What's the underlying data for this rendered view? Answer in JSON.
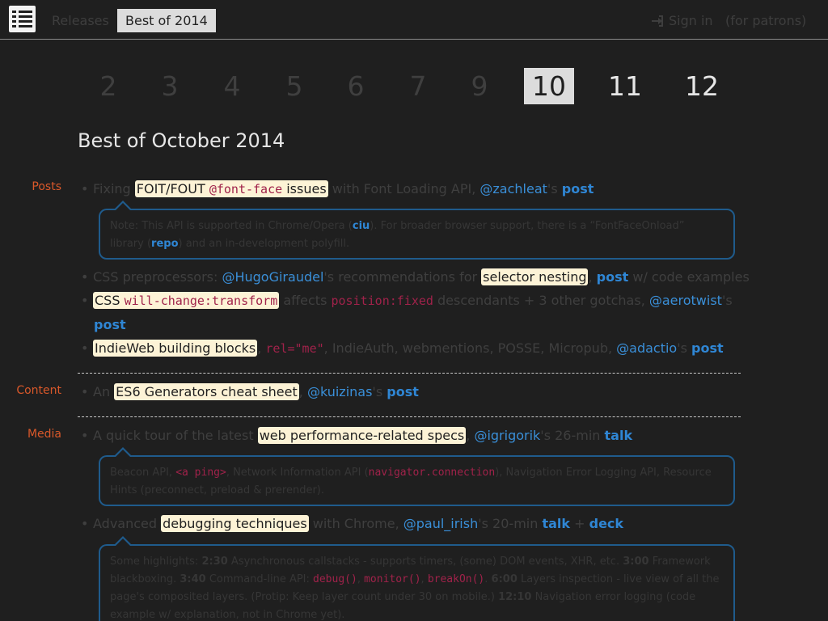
{
  "nav": {
    "releases": "Releases",
    "best_of": "Best of 2014",
    "sign_in": "Sign in",
    "patrons": "(for patrons)"
  },
  "months": [
    "2",
    "3",
    "4",
    "5",
    "6",
    "7",
    "9",
    "10",
    "11",
    "12"
  ],
  "active_month": "10",
  "page_title": "Best of October 2014",
  "sections": {
    "posts": "Posts",
    "content": "Content",
    "media": "Media"
  },
  "posts": [
    {
      "pre": "Fixing ",
      "hl_text": "FOIT/FOUT ",
      "hl_code": "@font-face",
      "hl_text2": " issues",
      "post_text": " with Font Loading API, ",
      "handle": "@zachleat",
      "apos": "'s ",
      "link": "post"
    },
    {
      "pre": "CSS preprocessors: ",
      "handle": "@HugoGiraudel",
      "mid": "'s recommendations for ",
      "hl_text": "selector nesting",
      "comma": ", ",
      "link": "post",
      "tail": " w/ code examples"
    },
    {
      "hl_text": "CSS ",
      "hl_code": "will-change:transform",
      "mid": " affects ",
      "code": "position:fixed",
      "tail": " descendants + 3 other gotchas, ",
      "handle": "@aerotwist",
      "apos": "'s",
      "link": "post"
    },
    {
      "hl_text": "IndieWeb building blocks",
      "comma": ", ",
      "code": "rel=\"me\"",
      "tail": ", IndieAuth, webmentions, POSSE, Micropub, ",
      "handle": "@adactio",
      "apos": "'s ",
      "link": "post"
    }
  ],
  "note1": {
    "a": "Note: This API is supported in Chrome/Opera (",
    "ciu": "ciu",
    "b": "). For broader browser support, there is a “FontFaceOnload”",
    "c": "library (",
    "repo": "repo",
    "d": ") and an in-development polyfill."
  },
  "content_item": {
    "pre": "An ",
    "hl_text": "ES6 Generators cheat sheet",
    "comma": ", ",
    "handle": "@kuizinas",
    "apos": "'s ",
    "link": "post"
  },
  "media": [
    {
      "pre": "A quick tour of the latest ",
      "hl_text": "web performance-related specs",
      "comma": ", ",
      "handle": "@igrigorik",
      "tail": "'s 26-min ",
      "link": "talk"
    },
    {
      "pre": "Advanced ",
      "hl_text": "debugging techniques",
      "mid": " with Chrome, ",
      "handle": "@paul_irish",
      "tail": "'s 20-min ",
      "link": "talk",
      "plus": " + ",
      "link2": "deck"
    }
  ],
  "note2": {
    "a": "Beacon API, ",
    "code1": "<a ping>",
    "b": ", Network Information API (",
    "code2": "navigator.connection",
    "c": "), Navigation Error Logging API, Resource",
    "d": "Hints (preconnect, preload & prerender)."
  },
  "note3": {
    "l1a": "Some highlights: ",
    "t1": "2:30",
    "l1b": " Asynchronous callstacks - supports timers, (some) DOM events, XHR, etc. ",
    "t2": "3:00",
    "l1c": " Framework",
    "l2a": "blackboxing. ",
    "t3": "3:40",
    "l2b": " Command-line API: ",
    "c1": "debug()",
    "c2": "monitor()",
    "c3": "breakOn()",
    "t4": "6:00",
    "l2c": " Layers inspection - live view of all the",
    "l3a": "page's composited layers. (Protip: Keep layer count under 30 on mobile.) ",
    "t5": "12:10",
    "l3b": " Navigation error logging (code",
    "l4a": "example w/ explanation, not in Chrome yet)."
  }
}
